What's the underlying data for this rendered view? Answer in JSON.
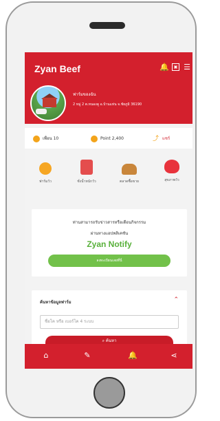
{
  "header": {
    "title": "Zyan Beef",
    "icons": [
      "bell-icon",
      "calendar-icon",
      "menu-icon"
    ]
  },
  "profile": {
    "name": "ฟาร์มของฉัน",
    "address": "2 หมู่ 2 ต.หนองคู อ.บ้านแท่น จ.ชัยภูมิ 36190"
  },
  "stats": {
    "friends": "เพื่อน 10",
    "points": "Point 2,400",
    "share": "แชร์"
  },
  "menu": [
    {
      "label": "ฟาร์มวัว",
      "icon": "farmer-icon"
    },
    {
      "label": "ชั่งน้ำหนักวัว",
      "icon": "scale-icon"
    },
    {
      "label": "ตลาดซื้อขาย",
      "icon": "cow-market-icon"
    },
    {
      "label": "สุขภาพวัว",
      "icon": "heart-icon"
    }
  ],
  "notify_card": {
    "line1": "ท่านสามารถรับข่าวสารหรือเตือนกิจกรรม",
    "line2": "ผ่านทางแอปพลิเคชัน",
    "brand": "Zyan Notify",
    "button": "ลงทะเบียนเลยที่นี่"
  },
  "search": {
    "title": "ค้นหาข้อมูลฟาร์ม",
    "placeholder": "ชื่อโค หรือ เบอร์โค 4 ระบบ",
    "button": "ค้นหา"
  },
  "bottom_nav": [
    "home-icon",
    "tag-icon",
    "bell-icon",
    "share-icon"
  ],
  "colors": {
    "brand_red": "#d3202d",
    "accent_green": "#58b03a",
    "button_green": "#72c14a",
    "coin_orange": "#f3a41b"
  }
}
